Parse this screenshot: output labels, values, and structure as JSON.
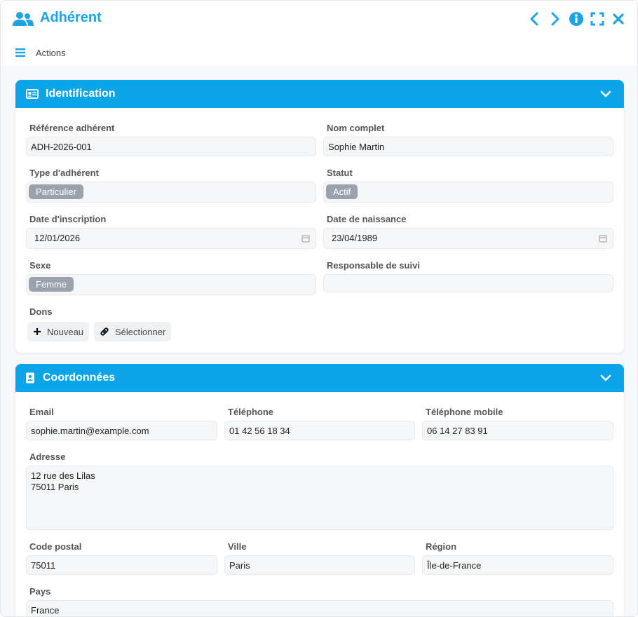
{
  "window": {
    "title": "Adhérent"
  },
  "menu": {
    "label": "Actions"
  },
  "identification": {
    "title": "Identification",
    "reference_label": "Référence adhérent",
    "reference_value": "ADH-2026-001",
    "name_label": "Nom complet",
    "name_value": "Sophie Martin",
    "type_label": "Type d'adhérent",
    "type_value": "Particulier",
    "status_label": "Statut",
    "status_value": "Actif",
    "signup_label": "Date d'inscription",
    "signup_value": "12/01/2026",
    "birth_label": "Date de naissance",
    "birth_value": "23/04/1989",
    "sex_label": "Sexe",
    "sex_value": "Femme",
    "manager_label": "Responsable de suivi",
    "manager_value": "",
    "dons_label": "Dons",
    "new_button": "Nouveau",
    "select_button": "Sélectionner"
  },
  "contact": {
    "title": "Coordonnées",
    "email_label": "Email",
    "email_value": "sophie.martin@example.com",
    "phone_label": "Téléphone",
    "phone_value": "01 42 56 18 34",
    "mobile_label": "Téléphone mobile",
    "mobile_value": "06 14 27 83 91",
    "address_label": "Adresse",
    "address_value": "12 rue des Lilas\n75011 Paris",
    "postal_label": "Code postal",
    "postal_value": "75011",
    "city_label": "Ville",
    "city_value": "Paris",
    "region_label": "Région",
    "region_value": "Île-de-France",
    "country_label": "Pays",
    "country_value": "France"
  },
  "colors": {
    "accent": "#0aa5e8",
    "title": "#1ea3e6",
    "tag": "#9aa3ad"
  },
  "icons": [
    "users-icon",
    "chevron-left-icon",
    "chevron-right-icon",
    "info-icon",
    "fullscreen-icon",
    "close-icon",
    "menu-icon",
    "id-card-icon",
    "contact-book-icon",
    "chevron-down-icon",
    "calendar-icon",
    "plus-icon",
    "link-icon"
  ]
}
